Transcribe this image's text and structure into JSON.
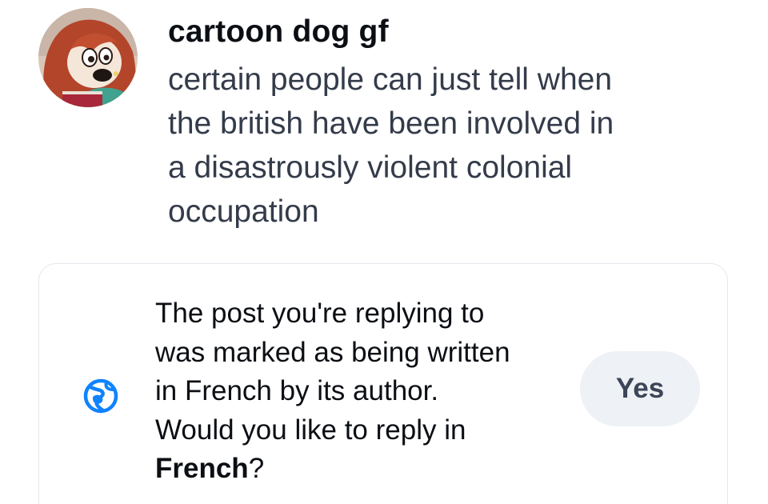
{
  "post": {
    "author": "cartoon dog gf",
    "text_lines": [
      "certain people can just tell when",
      "the british have been involved in",
      "a disastrously violent colonial",
      "occupation"
    ],
    "avatar_icon": "cartoon-dog-avatar"
  },
  "language_prompt": {
    "lines": [
      "The post you're replying to",
      "was marked as being written",
      "in French by its author.",
      "Would you like to reply in"
    ],
    "language": "French",
    "suffix": "?",
    "icon": "globe-icon",
    "accent_color": "#1083fe",
    "yes_label": "Yes"
  }
}
